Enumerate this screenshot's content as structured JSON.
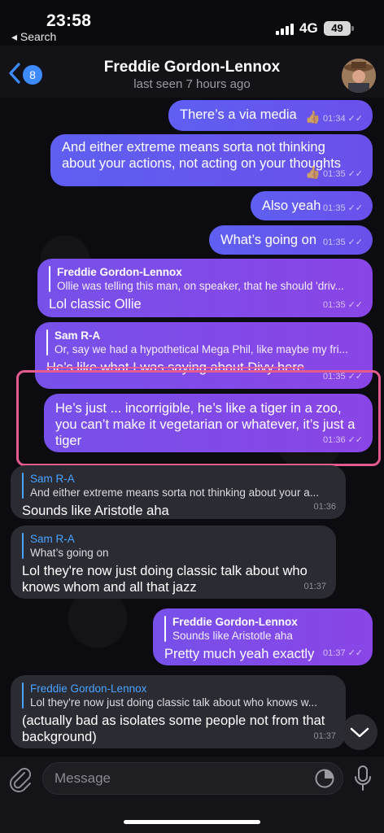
{
  "status_bar": {
    "time": "23:58",
    "back_label": "◂ Search",
    "network": "4G",
    "battery": "49"
  },
  "header": {
    "unread_count": "8",
    "contact_name": "Freddie Gordon-Lennox",
    "last_seen": "last seen 7 hours ago"
  },
  "messages": [
    {
      "text": "There’s a via media",
      "reaction": "👍",
      "time": "01:34"
    },
    {
      "text": "And either extreme means sorta not thinking about your actions, not acting on your thoughts",
      "reaction": "👍",
      "time": "01:35"
    },
    {
      "text": "Also yeah",
      "time": "01:35"
    },
    {
      "text": "What’s going on",
      "time": "01:35"
    },
    {
      "reply_author": "Freddie Gordon-Lennox",
      "reply_text": "Ollie was telling this man, on speaker, that he should 'driv...",
      "text": "Lol classic Ollie",
      "time": "01:35"
    },
    {
      "reply_author": "Sam R-A",
      "reply_text": "Or, say we had a hypothetical Mega Phil, like maybe my fri...",
      "text": "He’s like what I was saying about Divy here",
      "time": "01:35"
    },
    {
      "text": "He’s just ... incorrigible, he’s like a tiger in a zoo, you can’t make it vegetarian or whatever, it’s just a tiger",
      "time": "01:36"
    },
    {
      "reply_author": "Sam R-A",
      "reply_text": "And either extreme means sorta not thinking about your a...",
      "text": "Sounds like Aristotle aha",
      "time": "01:36"
    },
    {
      "reply_author": "Sam R-A",
      "reply_text": "What’s going on",
      "text": "Lol they're now just doing classic talk about who knows whom and all that jazz",
      "time": "01:37"
    },
    {
      "reply_author": "Freddie Gordon-Lennox",
      "reply_text": "Sounds like Aristotle aha",
      "text": "Pretty much yeah exactly",
      "time": "01:37"
    },
    {
      "reply_author": "Freddie Gordon-Lennox",
      "reply_text": "Lol they're now just doing classic talk about who knows w...",
      "text": "(actually bad as isolates some people not from that background)",
      "time": "01:37"
    }
  ],
  "composer": {
    "placeholder": "Message"
  },
  "colors": {
    "outgoing_blue": "#5f5ff2",
    "outgoing_violet": "#8a45e6",
    "incoming": "#2b2b33",
    "accent": "#3d8bff",
    "annotation": "#e25a8e"
  }
}
